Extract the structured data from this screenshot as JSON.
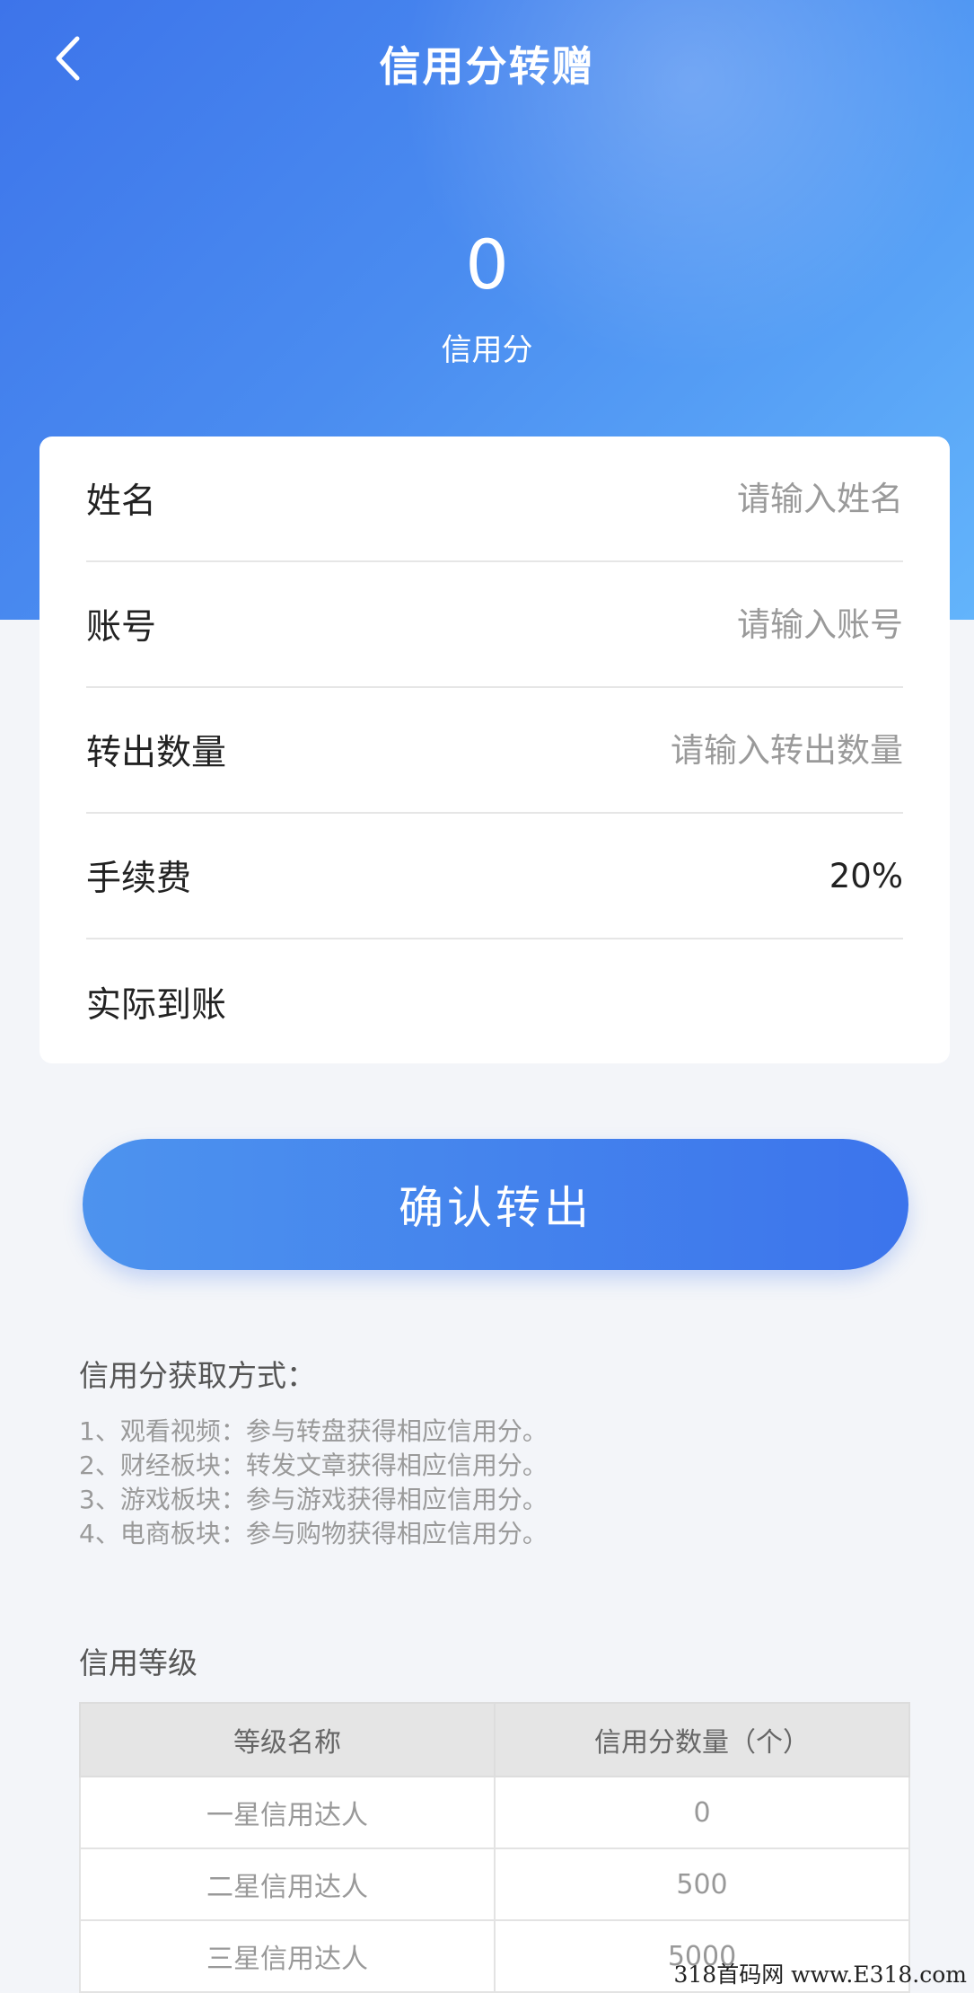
{
  "header": {
    "title": "信用分转赠",
    "back_icon": "chevron-left-icon"
  },
  "summary": {
    "score": "0",
    "score_label": "信用分"
  },
  "form": {
    "name_label": "姓名",
    "name_placeholder": "请输入姓名",
    "account_label": "账号",
    "account_placeholder": "请输入账号",
    "amount_label": "转出数量",
    "amount_placeholder": "请输入转出数量",
    "fee_label": "手续费",
    "fee_value": "20%",
    "actual_label": "实际到账",
    "actual_value": ""
  },
  "confirm_button": "确认转出",
  "earn": {
    "title": "信用分获取方式：",
    "items": [
      "1、观看视频：参与转盘获得相应信用分。",
      "2、财经板块：转发文章获得相应信用分。",
      "3、游戏板块：参与游戏获得相应信用分。",
      "4、电商板块：参与购物获得相应信用分。"
    ]
  },
  "levels": {
    "title": "信用等级",
    "headers": [
      "等级名称",
      "信用分数量（个）"
    ],
    "rows": [
      [
        "一星信用达人",
        "0"
      ],
      [
        "二星信用达人",
        "500"
      ],
      [
        "三星信用达人",
        "5000"
      ]
    ]
  },
  "watermark": "318首码网 www.E318.com",
  "colors": {
    "primary": "#3c74ec",
    "hero_light": "#63b4fb",
    "background": "#f3f5f9"
  }
}
